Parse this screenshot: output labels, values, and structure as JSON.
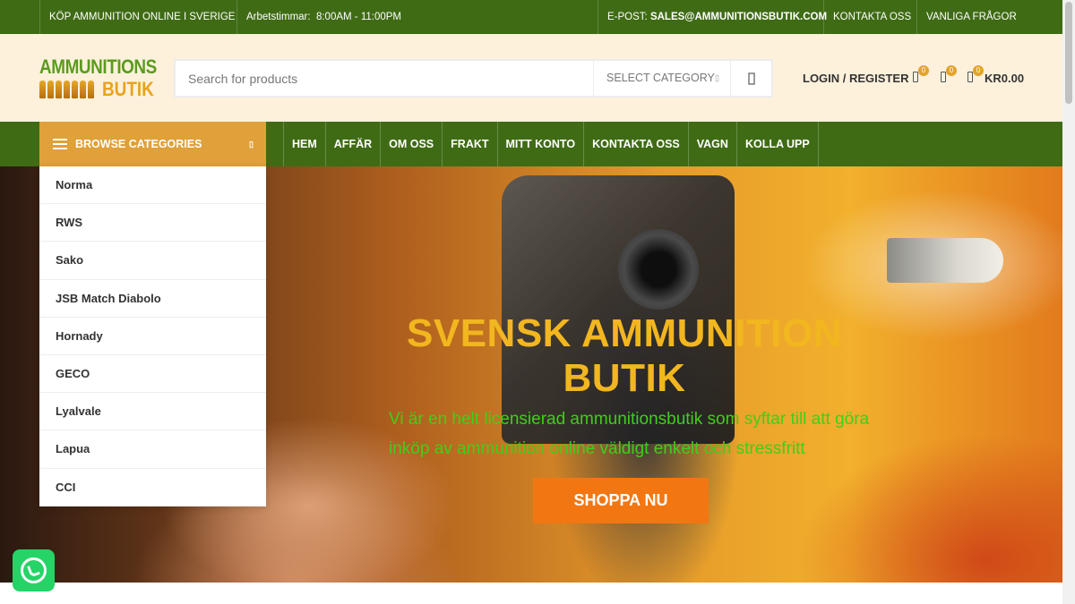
{
  "topbar": {
    "tagline": "KÖP AMMUNITION ONLINE I SVERIGE",
    "hours_label": "Arbetstimmar:",
    "hours_value": "8:00AM - 11:00PM",
    "email_label": "E-POST:",
    "email_value": "SALES@AMMUNITIONSBUTIK.COM",
    "contact": "KONTAKTA OSS",
    "faq": "VANLIGA FRÅGOR"
  },
  "logo": {
    "line1": "AMMUNITIONS",
    "line2": "BUTIK"
  },
  "search": {
    "placeholder": "Search for products",
    "category": "SELECT CATEGORY"
  },
  "header": {
    "login": "LOGIN / REGISTER",
    "compare_count": "0",
    "wishlist_count": "0",
    "cart_count": "0",
    "cart_total": "KR0.00"
  },
  "nav": {
    "browse": "BROWSE CATEGORIES",
    "items": [
      "HEM",
      "AFFÄR",
      "OM OSS",
      "FRAKT",
      "MITT KONTO",
      "KONTAKTA OSS",
      "VAGN",
      "KOLLA UPP"
    ]
  },
  "categories": [
    "Norma",
    "RWS",
    "Sako",
    "JSB Match Diabolo",
    "Hornady",
    "GECO",
    "Lyalvale",
    "Lapua",
    "CCI"
  ],
  "hero": {
    "title_line1": "SVENSK AMMUNITION",
    "title_line2": "BUTIK",
    "subtitle_line1": "Vi är en helt licensierad ammunitionsbutik som syftar till att göra",
    "subtitle_line2": "inköp av ammunition online väldigt enkelt och stressfritt",
    "cta": "SHOPPA NU"
  },
  "colors": {
    "green": "#3f6b15",
    "orange": "#e0a03a",
    "cta": "#f27712",
    "title": "#f2b61f",
    "subtitle": "#3fcf1a"
  },
  "icons": [
    "search-icon",
    "compare-icon",
    "wishlist-icon",
    "cart-icon",
    "menu-icon",
    "chevron-down-icon",
    "whatsapp-icon"
  ]
}
